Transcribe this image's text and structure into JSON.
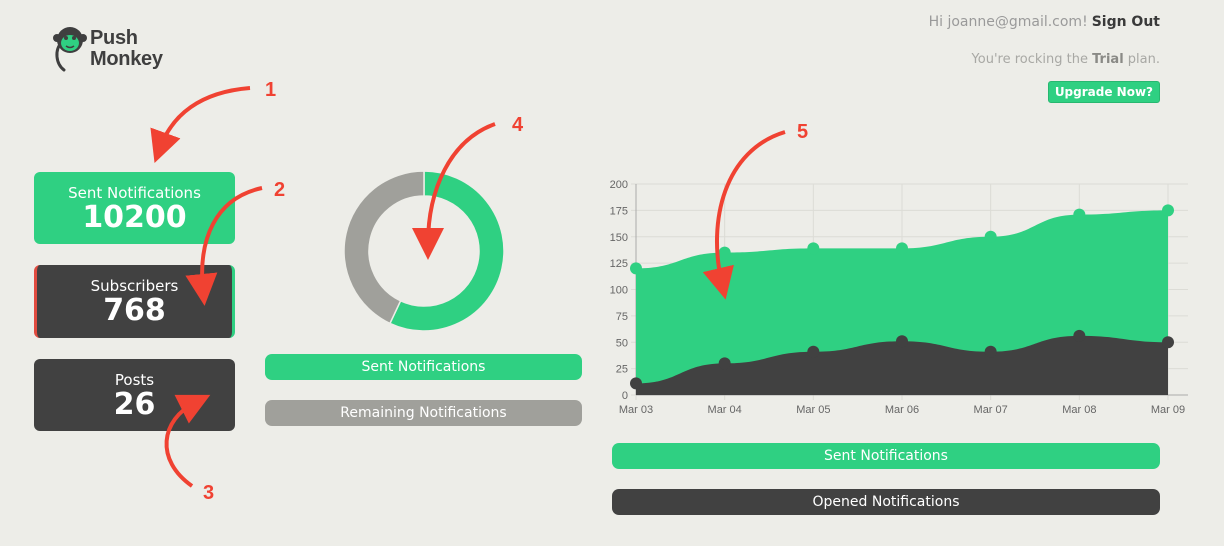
{
  "app": {
    "brand_line1": "Push",
    "brand_line2": "Monkey",
    "logo_icon": "monkey-icon"
  },
  "header": {
    "greeting": "Hi joanne@gmail.com!",
    "sign_out_label": "Sign Out",
    "plan_prefix": "You're rocking the ",
    "plan_name": "Trial",
    "plan_suffix": " plan.",
    "upgrade_label": "Upgrade Now?"
  },
  "stats": {
    "sent": {
      "label": "Sent Notifications",
      "value": "10200"
    },
    "subscribers": {
      "label": "Subscribers",
      "value": "768"
    },
    "posts": {
      "label": "Posts",
      "value": "26"
    }
  },
  "colors": {
    "accent": "#2fd082",
    "dark": "#414141",
    "gray": "#a0a09b",
    "annotation": "#f04232"
  },
  "annotations": [
    "1",
    "2",
    "3",
    "4",
    "5"
  ],
  "chart_data": [
    {
      "type": "pie",
      "variant": "doughnut",
      "labels": [
        "Sent Notifications",
        "Remaining Notifications"
      ],
      "values": [
        57,
        43
      ],
      "colors": [
        "#2fd082",
        "#a0a09b"
      ]
    },
    {
      "type": "area",
      "categories": [
        "Mar 03",
        "Mar 04",
        "Mar 05",
        "Mar 06",
        "Mar 07",
        "Mar 08",
        "Mar 09"
      ],
      "ylim": [
        0,
        200
      ],
      "yticks": [
        "0",
        "25",
        "50",
        "75",
        "100",
        "125",
        "150",
        "175",
        "200"
      ],
      "grid": true,
      "series": [
        {
          "name": "Sent Notifications",
          "values": [
            120,
            135,
            139,
            139,
            150,
            171,
            175
          ],
          "color": "#2fd082"
        },
        {
          "name": "Opened Notifications",
          "values": [
            11,
            30,
            41,
            51,
            41,
            56,
            50
          ],
          "color": "#414141"
        }
      ]
    }
  ]
}
